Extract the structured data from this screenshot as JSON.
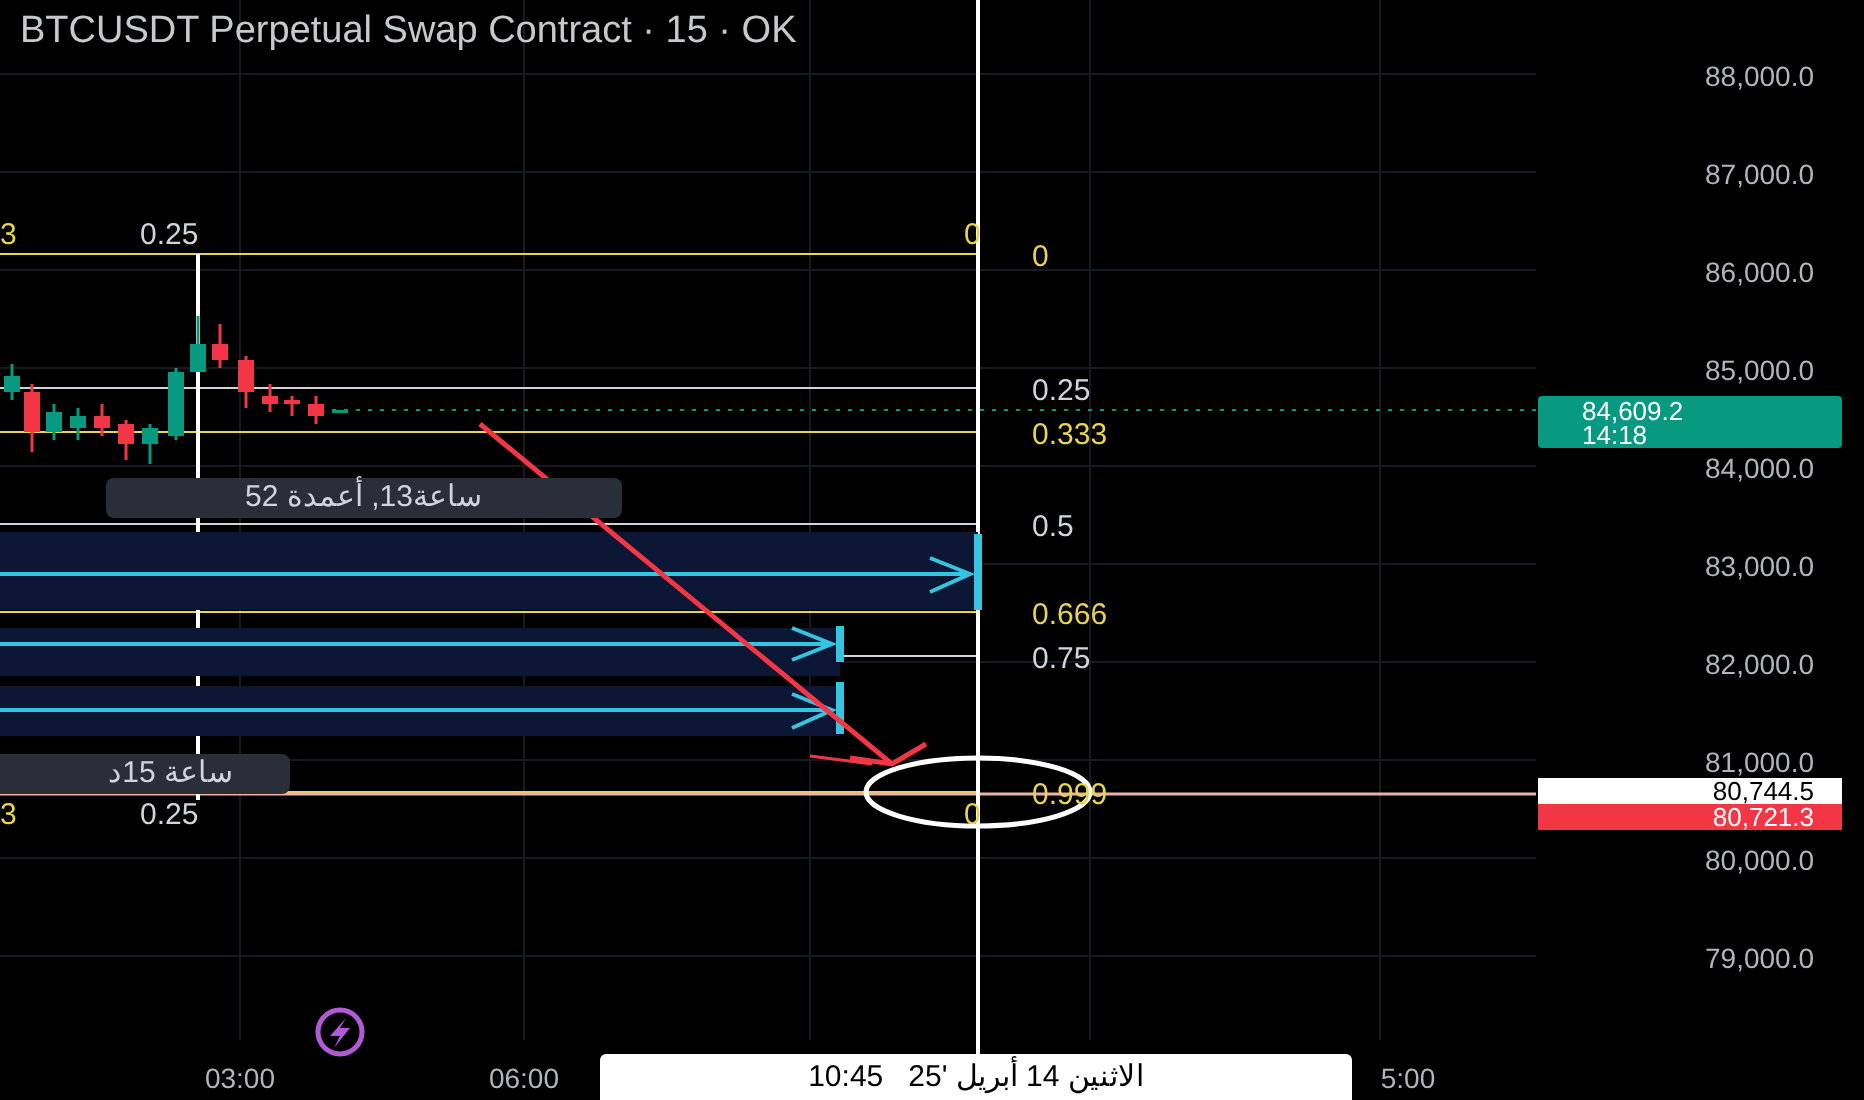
{
  "title": "BTCUSDT Perpetual Swap Contract · 15 · OK",
  "price_axis": [
    "88,000.0",
    "87,000.0",
    "86,000.0",
    "85,000.0",
    "84,000.0",
    "83,000.0",
    "82,000.0",
    "81,000.0",
    "80,000.0",
    "79,000.0"
  ],
  "fib_levels": [
    {
      "label": "0",
      "color": "#e8d44d"
    },
    {
      "label": "0.25",
      "color": "#d1d4dc"
    },
    {
      "label": "0.333",
      "color": "#e8d44d"
    },
    {
      "label": "0.5",
      "color": "#d1d4dc"
    },
    {
      "label": "0.666",
      "color": "#e8d44d"
    },
    {
      "label": "0.75",
      "color": "#d1d4dc"
    },
    {
      "label": "0.999",
      "color": "#e8d44d"
    }
  ],
  "top_labels": [
    {
      "text": "3",
      "color": "#e8d44d"
    },
    {
      "text": "0.25",
      "color": "#d1d4dc"
    },
    {
      "text": "0",
      "color": "#e8d44d"
    }
  ],
  "bottom_labels": [
    {
      "text": "3",
      "color": "#e8d44d"
    },
    {
      "text": "0.25",
      "color": "#d1d4dc"
    },
    {
      "text": "0",
      "color": "#e8d44d"
    }
  ],
  "measure_tooltips": [
    "ساعة13, أعمدة 52",
    "ساعة 15د"
  ],
  "last_price": {
    "price": "84,609.2",
    "countdown": "14:18"
  },
  "price_tags": [
    {
      "text": "80,744.5",
      "kind": "crosshair"
    },
    {
      "text": "80,721.3",
      "kind": "alert"
    }
  ],
  "time_axis": [
    "03:00",
    "06:00",
    "5:00"
  ],
  "crosshair_time": "الاثنين 14 أبريل '25   10:45"
}
